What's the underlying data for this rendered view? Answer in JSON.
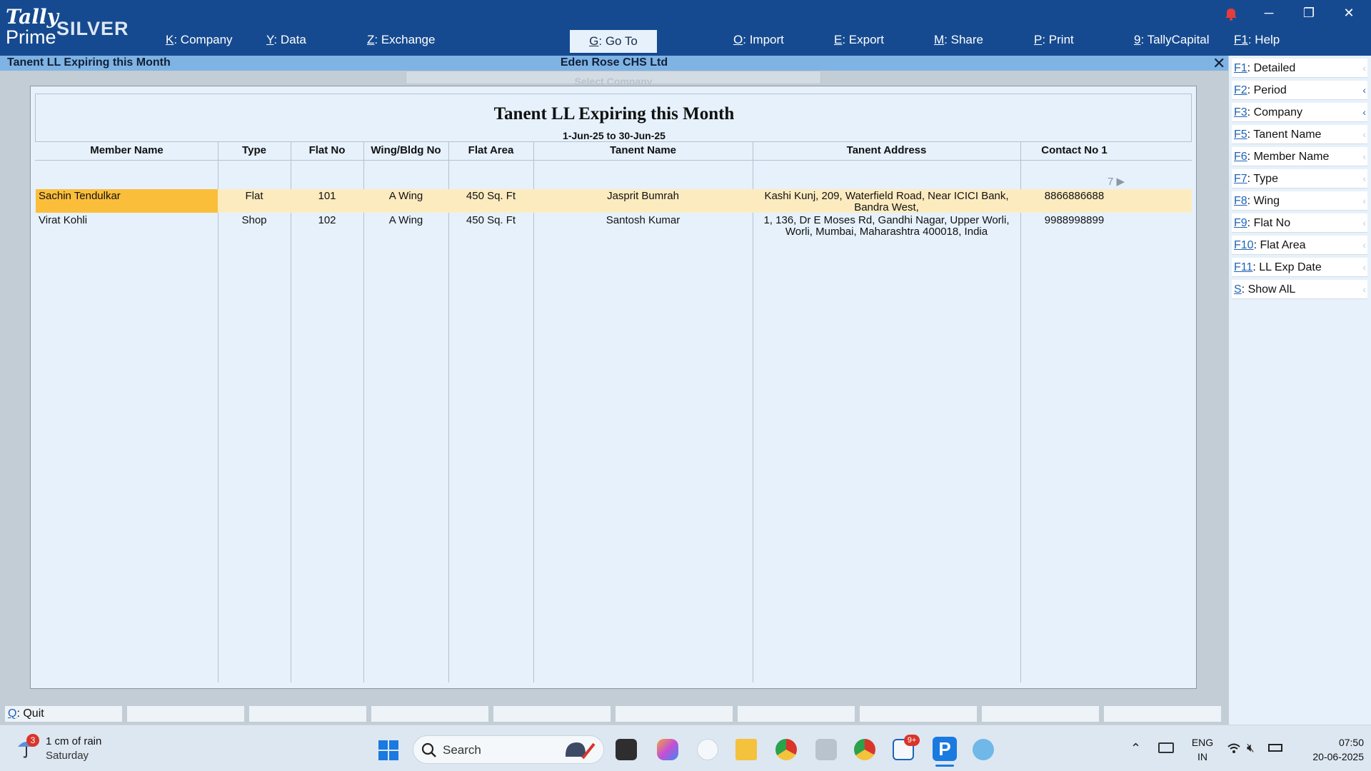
{
  "app": {
    "brand_line1": "Tally",
    "brand_line2": "Prime",
    "edition": "SILVER"
  },
  "topmenu": [
    {
      "key": "K",
      "label": "Company"
    },
    {
      "key": "Y",
      "label": "Data"
    },
    {
      "key": "Z",
      "label": "Exchange"
    },
    {
      "key": "G",
      "label": "Go To"
    },
    {
      "key": "O",
      "label": "Import"
    },
    {
      "key": "E",
      "label": "Export"
    },
    {
      "key": "M",
      "label": "Share"
    },
    {
      "key": "P",
      "label": "Print"
    },
    {
      "key": "9",
      "label": "TallyCapital"
    },
    {
      "key": "F1",
      "label": "Help"
    }
  ],
  "titlebar": {
    "report_name": "Tanent LL Expiring this Month",
    "company": "Eden Rose CHS Ltd",
    "close_glyph": "✕"
  },
  "report": {
    "title": "Tanent LL Expiring this Month",
    "period": "1-Jun-25 to 30-Jun-25",
    "ghost_label": "Select Company",
    "page_indicator": "7 ▶",
    "columns": [
      "Member Name",
      "Type",
      "Flat No",
      "Wing/Bldg No",
      "Flat Area",
      "Tanent Name",
      "Tanent Address",
      "Contact No 1"
    ],
    "rows": [
      {
        "member": "Sachin Tendulkar",
        "type": "Flat",
        "flat_no": "101",
        "wing": "A Wing",
        "area": "450 Sq. Ft",
        "tenant": "Jasprit Bumrah",
        "address_1": "Kashi Kunj, 209, Waterfield Road, Near ICICI Bank,",
        "address_2": "Bandra West,",
        "contact": "8866886688"
      },
      {
        "member": "Virat Kohli",
        "type": "Shop",
        "flat_no": "102",
        "wing": "A Wing",
        "area": "450 Sq. Ft",
        "tenant": "Santosh Kumar",
        "address_1": "1, 136, Dr E Moses Rd, Gandhi Nagar, Upper Worli,",
        "address_2": "Worli, Mumbai, Maharashtra 400018, India",
        "contact": "9988998899"
      }
    ]
  },
  "sidebar": [
    {
      "key": "F1",
      "label": "Detailed"
    },
    {
      "key": "F2",
      "label": "Period"
    },
    {
      "key": "F3",
      "label": "Company"
    },
    {
      "key": "F5",
      "label": "Tanent Name"
    },
    {
      "key": "F6",
      "label": "Member Name"
    },
    {
      "key": "F7",
      "label": "Type"
    },
    {
      "key": "F8",
      "label": "Wing"
    },
    {
      "key": "F9",
      "label": "Flat No"
    },
    {
      "key": "F10",
      "label": "Flat Area"
    },
    {
      "key": "F11",
      "label": "LL Exp Date"
    },
    {
      "key": "S",
      "label": "Show AlL"
    }
  ],
  "bottom": {
    "quit_key": "Q",
    "quit_label": "Quit"
  },
  "taskbar": {
    "weather_badge": "3",
    "weather_text": "1 cm of rain",
    "weather_day": "Saturday",
    "search_placeholder": "Search",
    "mail_badge": "9+",
    "lang_1": "ENG",
    "lang_2": "IN",
    "time": "07:50",
    "date": "20-06-2025"
  },
  "colors": {
    "topbar": "#164a90",
    "titlebar": "#7fb3e3",
    "highlight_row": "#fdebc0",
    "highlight_cell": "#fbbe3b"
  }
}
